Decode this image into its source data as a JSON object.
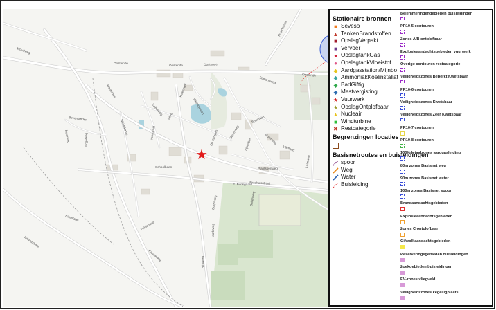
{
  "map": {
    "street_labels": [
      "Oostende",
      "Oostende",
      "Oostende",
      "Oosteinde",
      "Woudweg",
      "Boterweg",
      "Bovenlanden",
      "Weidekamp",
      "Voorstraat",
      "Schoolbaan",
      "Kerkstraat",
      "Raadhuisstraat",
      "Plantsoenweg",
      "Lijsterbes",
      "Molenweg",
      "Vlietland",
      "Westeinde",
      "Marktweg",
      "Dorpsweg",
      "Bovenweg",
      "Singelweg",
      "Kastanjelaan",
      "Zuiderweg",
      "Linde",
      "Buitenweg",
      "De Kampen",
      "Polderweg",
      "Julianastraat",
      "Eikenlaan",
      "Stationsweg",
      "Laanweg",
      "Hoofdstraat",
      "Sportlaan",
      "E. Bunsgaard",
      "Ringweg",
      "Kanaalweg"
    ],
    "marker": {
      "symbol": "★",
      "color": "#e11b1b"
    }
  },
  "legend": {
    "stationaire_title": "Stationaire bronnen",
    "stationaire": [
      {
        "label": "Seveso",
        "icon": "orange-square",
        "symbol": "■",
        "color": "#f07a1c"
      },
      {
        "label": "TankenBrandstoffen",
        "icon": "red-triangle",
        "symbol": "▲",
        "color": "#c0392b"
      },
      {
        "label": "OpslagVerpakt",
        "icon": "darkred-square",
        "symbol": "■",
        "color": "#a01c2c"
      },
      {
        "label": "Vervoer",
        "icon": "purple-square",
        "symbol": "■",
        "color": "#6b3b8c"
      },
      {
        "label": "OpslagtankGas",
        "icon": "red-dot",
        "symbol": "●",
        "color": "#d0203a"
      },
      {
        "label": "OpslagtankVloeistof",
        "icon": "pink-dot",
        "symbol": "●",
        "color": "#e05a8a"
      },
      {
        "label": "Aardgasstation/Mijnbo",
        "icon": "yellow-diamond",
        "symbol": "◆",
        "color": "#e7c51a"
      },
      {
        "label": "AmmoniakKoelinstallat",
        "icon": "teal-diamond",
        "symbol": "◆",
        "color": "#3aa3a0"
      },
      {
        "label": "BadGiftig",
        "icon": "green-diamond",
        "symbol": "◆",
        "color": "#2fa84a"
      },
      {
        "label": "Mestvergisting",
        "icon": "blue-diamond",
        "symbol": "◆",
        "color": "#2b6cb0"
      },
      {
        "label": "Vuurwerk",
        "icon": "red-star",
        "symbol": "★",
        "color": "#d11a1a"
      },
      {
        "label": "OpslagOntplofbaar",
        "icon": "olive-star",
        "symbol": "★",
        "color": "#9a9a2a"
      },
      {
        "label": "Nucleair",
        "icon": "yellow-triangle",
        "symbol": "▲",
        "color": "#e8c21c"
      },
      {
        "label": "Windturbine",
        "icon": "green-square",
        "symbol": "■",
        "color": "#2fbf3a"
      },
      {
        "label": "Restcategorie",
        "icon": "red-cross",
        "symbol": "✖",
        "color": "#c0392b"
      }
    ],
    "begrenzingen_title": "Begrenzingen locaties",
    "begrenzingen_color": "#8b4a1c",
    "basisnet_title": "Basisnetroutes en buisleidingen",
    "basisnet": [
      {
        "label": "spoor",
        "icon": "rail-line",
        "color": "#7b2a7b"
      },
      {
        "label": "Weg",
        "icon": "road-line",
        "color": "#e88a1c"
      },
      {
        "label": "Water",
        "icon": "water-line",
        "color": "#2860b0"
      },
      {
        "label": "Buisleiding",
        "icon": "pipeline-line",
        "color": "#e03030"
      }
    ],
    "zones": [
      {
        "label": "Belemmeringengebieden buisleidingen",
        "color": "#9c2dc8",
        "style": "dotted"
      },
      {
        "label": "PR10-5 contouren",
        "color": "#9c2dc8",
        "style": "dotted"
      },
      {
        "label": "Zones A/B ontplofbaar",
        "color": "#9c2dc8",
        "style": "dotted"
      },
      {
        "label": "Explosieaandachtsgebieden vuurwerk",
        "color": "#9c2dc8",
        "style": "dotted"
      },
      {
        "label": "Overige contouren restcategorie",
        "color": "#9c2dc8",
        "style": "dotted"
      },
      {
        "label": "Veiligheidszones Beperkt Kwetsbaar",
        "color": "#9c2dc8",
        "style": "dotted"
      },
      {
        "label": "PR10-6 contouren",
        "color": "#3b4fd8",
        "style": "dotted"
      },
      {
        "label": "Veiligheidszones Kwetsbaar",
        "color": "#3b4fd8",
        "style": "dotted"
      },
      {
        "label": "Veiligheidszones Zeer Kwetsbaar",
        "color": "#3b4fd8",
        "style": "dotted"
      },
      {
        "label": "PR10-7 contouren",
        "color": "#e6d64a",
        "style": "solid"
      },
      {
        "label": "PR10-8 contouren",
        "color": "#45b34a",
        "style": "dotted"
      },
      {
        "label": "100% letaalzones aardgasleiding",
        "color": "#3b4fd8",
        "style": "dotted"
      },
      {
        "label": "80m zones Basisnet weg",
        "color": "#3b4fd8",
        "style": "dotted"
      },
      {
        "label": "90m zones Basisnet water",
        "color": "#3b4fd8",
        "style": "dotted"
      },
      {
        "label": "100m zones Basisnet spoor",
        "color": "#3b4fd8",
        "style": "dotted"
      },
      {
        "label": "Brandaandachtsgebieden",
        "color": "#e03030",
        "style": "solid"
      },
      {
        "label": "Explosieaandachtsgebieden",
        "color": "#f0a030",
        "style": "solid"
      },
      {
        "label": "Zones C ontplofbaar",
        "color": "#f0a030",
        "style": "solid"
      },
      {
        "label": "Gifwolkaandachtsgebieden",
        "color": "#f5e84a",
        "style": "fill"
      },
      {
        "label": "Reserveringsgebieden buisleidingen",
        "color": "#d89ad8",
        "style": "fill"
      },
      {
        "label": "Zoekgebieden buisleidingen",
        "color": "#d89ad8",
        "style": "fill"
      },
      {
        "label": "EV-zones vliegveld",
        "color": "#d89ad8",
        "style": "fill"
      },
      {
        "label": "Veiligheidszones kegelligplaats",
        "color": "#d89ad8",
        "style": "fill"
      }
    ]
  }
}
